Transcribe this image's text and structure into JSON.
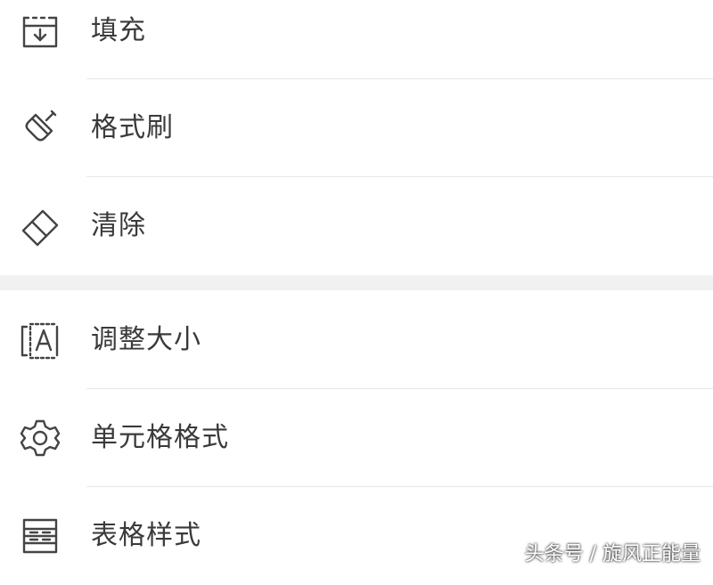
{
  "menu": {
    "group1": [
      {
        "label": "填充",
        "icon": "fill-icon"
      },
      {
        "label": "格式刷",
        "icon": "format-painter-icon"
      },
      {
        "label": "清除",
        "icon": "eraser-icon"
      }
    ],
    "group2": [
      {
        "label": "调整大小",
        "icon": "resize-icon"
      },
      {
        "label": "单元格格式",
        "icon": "gear-icon"
      },
      {
        "label": "表格样式",
        "icon": "table-style-icon"
      }
    ]
  },
  "watermark": "头条号 / 旋风正能量"
}
